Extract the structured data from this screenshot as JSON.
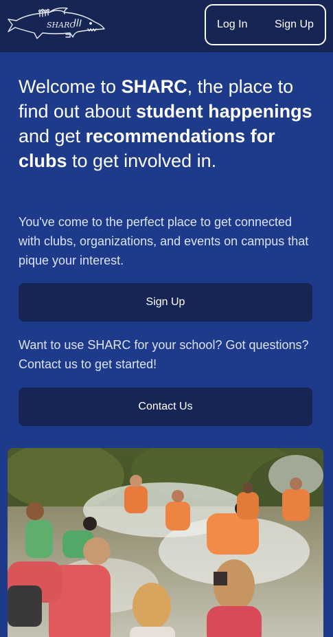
{
  "header": {
    "logo_text": "SHARC",
    "login_label": "Log In",
    "signup_label": "Sign Up"
  },
  "hero": {
    "title_parts": [
      "Welcome to ",
      "SHARC",
      ", the place to find out about ",
      "student happenings",
      " and get ",
      "recommendations for clubs",
      " to get involved in."
    ],
    "subtitle": "You've come to the perfect place to get connected with clubs, organizations, and events on campus that pique your interest.",
    "signup_button": "Sign Up",
    "contact_text": "Want to use SHARC for your school? Got questions? Contact us to get started!",
    "contact_button": "Contact Us"
  },
  "colors": {
    "page_bg": "#1e3a8a",
    "header_bg": "#172554",
    "button_bg": "#172554",
    "text": "#ffffff"
  },
  "icons": {
    "logo": "shark-logo-icon"
  }
}
